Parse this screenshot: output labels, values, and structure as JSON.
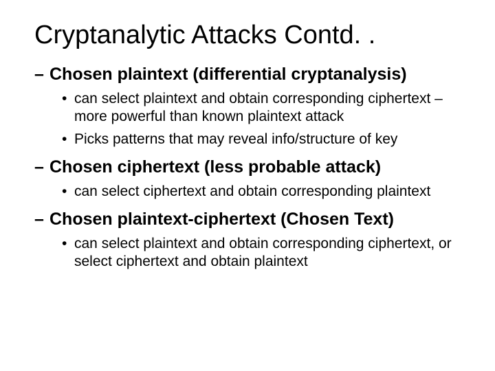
{
  "title": "Cryptanalytic Attacks Contd. .",
  "sections": [
    {
      "heading": "Chosen plaintext (differential cryptanalysis)",
      "bullets": [
        "can select plaintext and obtain corresponding ciphertext – more powerful than known plaintext attack",
        "Picks patterns that may reveal info/structure of key"
      ]
    },
    {
      "heading": "Chosen ciphertext (less probable attack)",
      "bullets": [
        "can select ciphertext and obtain corresponding plaintext"
      ]
    },
    {
      "heading": "Chosen plaintext-ciphertext (Chosen Text)",
      "bullets": [
        "can select plaintext and obtain corresponding ciphertext, or select ciphertext and obtain plaintext"
      ]
    }
  ]
}
